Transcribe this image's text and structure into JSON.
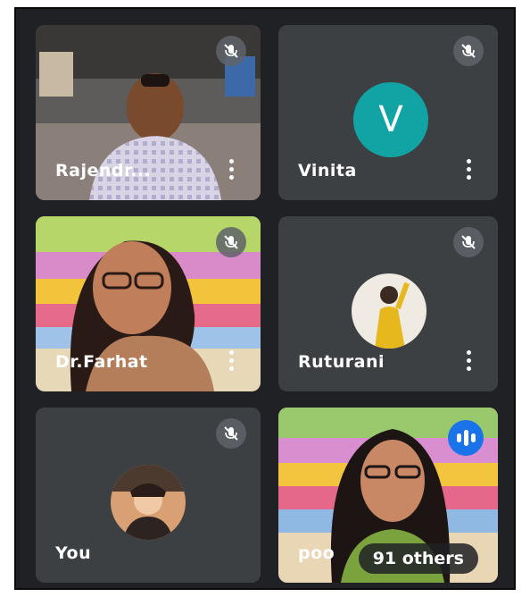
{
  "participants": [
    {
      "name": "Rajendr...",
      "muted": true,
      "video": true
    },
    {
      "name": "Vinita",
      "muted": true,
      "video": false,
      "avatar_letter": "V",
      "avatar_color": "#12a4a4"
    },
    {
      "name": "Dr.Farhat",
      "muted": true,
      "video": true
    },
    {
      "name": "Ruturani",
      "muted": true,
      "video": false
    },
    {
      "name": "You",
      "muted": true,
      "video": false
    },
    {
      "name": "poo",
      "speaking": true,
      "video": true,
      "overflow_label": "91 others"
    }
  ],
  "icons": {
    "mute": "mic-off-icon",
    "more": "more-vert-icon",
    "speaking": "audio-level-icon"
  },
  "colors": {
    "background": "#202124",
    "tile": "#3c4043",
    "speaking_accent": "#1a73e8"
  }
}
